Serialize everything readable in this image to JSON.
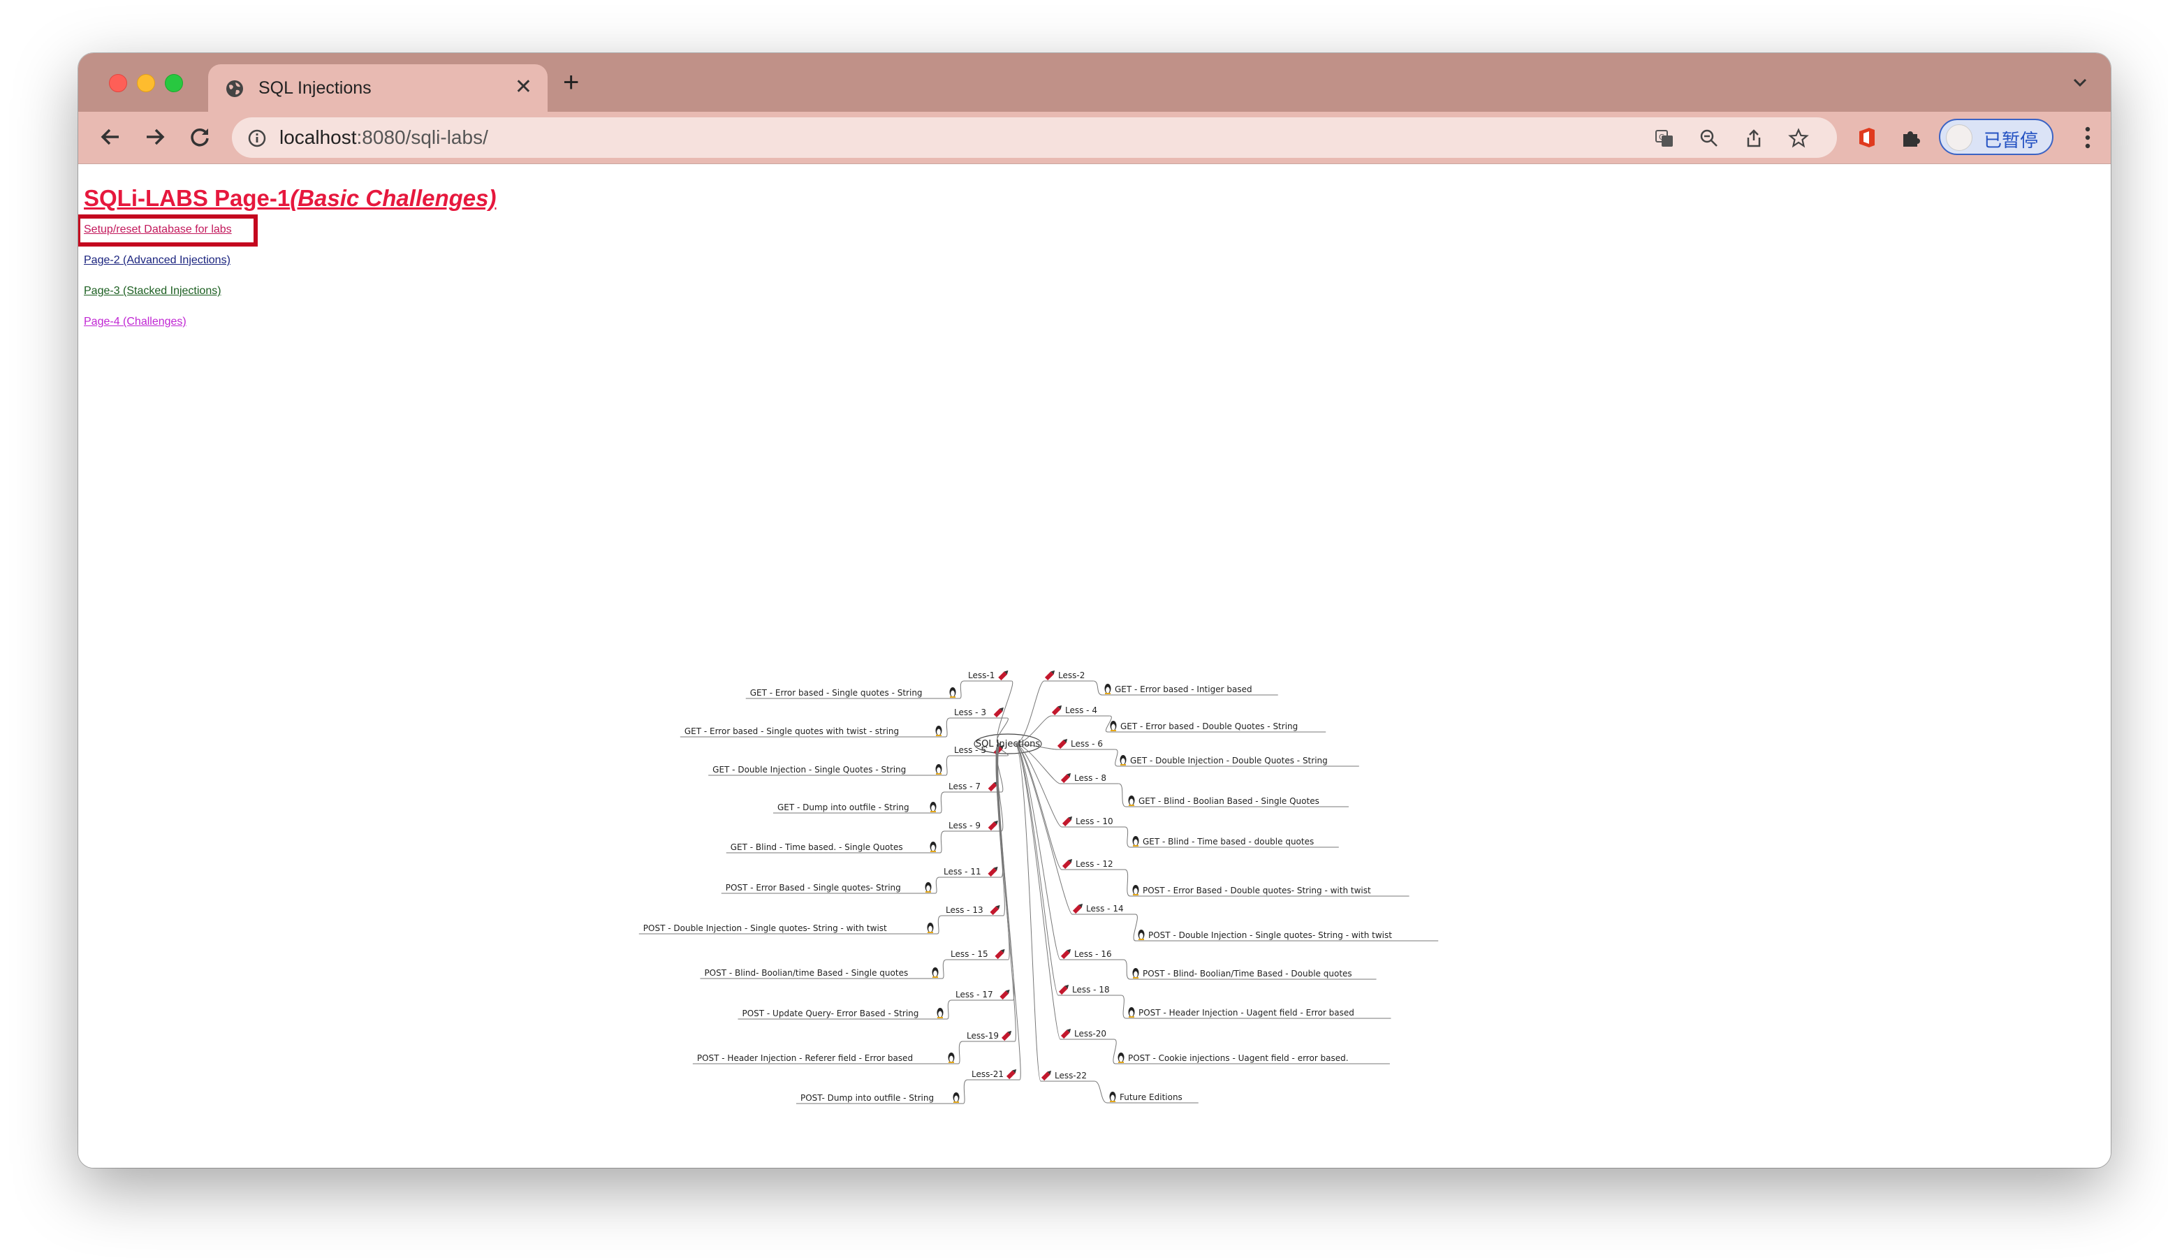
{
  "browser": {
    "tab_title": "SQL Injections",
    "url_host": "localhost",
    "url_path": ":8080/sqli-labs/",
    "profile_label": "已暂停"
  },
  "page": {
    "title": "SQLi-LABS Page-1",
    "title_sub": "(Basic Challenges)",
    "links": {
      "setup": "Setup/reset Database for labs",
      "page2": "Page-2 (Advanced Injections)",
      "page3": "Page-3 (Stacked Injections)",
      "page4": "Page-4 (Challenges)"
    }
  },
  "mindmap": {
    "center": "SQL Injections",
    "left": [
      {
        "less": "Less-1",
        "desc": "GET - Error based - Single quotes - String"
      },
      {
        "less": "Less - 3",
        "desc": "GET - Error based - Single quotes with twist - string"
      },
      {
        "less": "Less - 5",
        "desc": "GET - Double Injection - Single Quotes - String"
      },
      {
        "less": "Less - 7",
        "desc": "GET - Dump into outfile - String"
      },
      {
        "less": "Less - 9",
        "desc": "GET - Blind - Time based. -  Single Quotes"
      },
      {
        "less": "Less - 11",
        "desc": "POST - Error Based - Single quotes- String"
      },
      {
        "less": "Less - 13",
        "desc": "POST - Double Injection - Single quotes- String - with twist"
      },
      {
        "less": "Less - 15",
        "desc": "POST - Blind- Boolian/time Based - Single quotes"
      },
      {
        "less": "Less - 17",
        "desc": "POST - Update Query- Error Based - String"
      },
      {
        "less": "Less-19",
        "desc": "POST - Header Injection - Referer field - Error based"
      },
      {
        "less": "Less-21",
        "desc": "POST- Dump into outfile - String"
      }
    ],
    "right": [
      {
        "less": "Less-2",
        "desc": "GET - Error based - Intiger based"
      },
      {
        "less": "Less - 4",
        "desc": "GET - Error based - Double Quotes - String"
      },
      {
        "less": "Less - 6",
        "desc": "GET - Double Injection - Double Quotes - String"
      },
      {
        "less": "Less - 8",
        "desc": "GET - Blind - Boolian Based - Single Quotes"
      },
      {
        "less": "Less - 10",
        "desc": "GET - Blind - Time based - double quotes"
      },
      {
        "less": "Less - 12",
        "desc": "POST - Error Based - Double quotes- String - with twist"
      },
      {
        "less": "Less - 14",
        "desc": "POST - Double Injection - Single quotes- String - with twist"
      },
      {
        "less": "Less - 16",
        "desc": "POST - Blind- Boolian/Time Based - Double quotes"
      },
      {
        "less": "Less - 18",
        "desc": "POST - Header Injection - Uagent field - Error based"
      },
      {
        "less": "Less-20",
        "desc": "POST - Cookie injections - Uagent field - error based."
      },
      {
        "less": "Less-22",
        "desc": "Future Editions"
      }
    ]
  }
}
